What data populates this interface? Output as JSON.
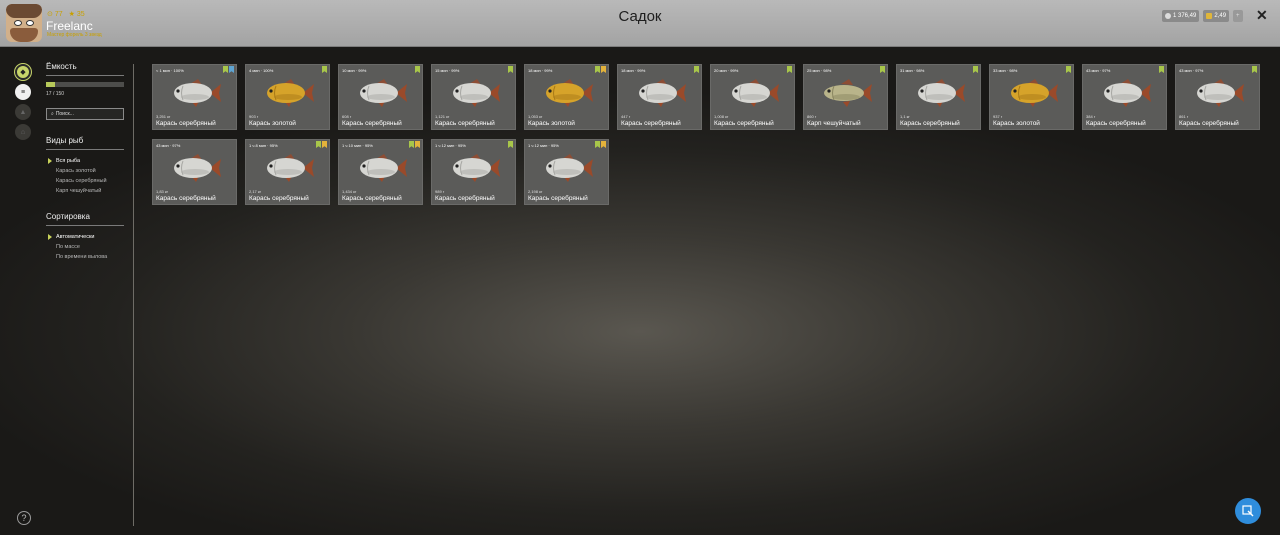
{
  "header": {
    "player_name": "Freelanc",
    "subtitle": "Мастер форель 3 звезд",
    "stat_level": "77",
    "stat_rank": "35",
    "title": "Садок",
    "silver": "1 376,49",
    "gold": "2,49",
    "plus": "+",
    "close": "✕"
  },
  "sidebar": {
    "capacity_title": "Ёмкость",
    "capacity_value": "17 / 150",
    "capacity_fraction": 0.113,
    "search_placeholder": "Поиск...",
    "species_title": "Виды рыб",
    "species": [
      "Вся рыба",
      "Карась золотой",
      "Карась серебряный",
      "Карп чешуйчатый"
    ],
    "sort_title": "Сортировка",
    "sort_options": [
      "Автоматически",
      "По массе",
      "По времени вылова"
    ],
    "help": "?"
  },
  "fish": [
    {
      "time": "< 1 мин · 100%",
      "weight": "3,251 кг",
      "name": "Карась серебряный",
      "kind": "silver",
      "tags": [
        "green",
        "blue"
      ]
    },
    {
      "time": "4 мин · 100%",
      "weight": "903 г",
      "name": "Карась золотой",
      "kind": "gold",
      "tags": [
        "green"
      ]
    },
    {
      "time": "10 мин · 99%",
      "weight": "608 г",
      "name": "Карась серебряный",
      "kind": "silver",
      "tags": [
        "green"
      ]
    },
    {
      "time": "15 мин · 99%",
      "weight": "1,121 кг",
      "name": "Карась серебряный",
      "kind": "silver",
      "tags": [
        "green"
      ]
    },
    {
      "time": "18 мин · 99%",
      "weight": "1,053 кг",
      "name": "Карась золотой",
      "kind": "gold",
      "tags": [
        "green",
        "gold"
      ]
    },
    {
      "time": "18 мин · 99%",
      "weight": "447 г",
      "name": "Карась серебряный",
      "kind": "silver",
      "tags": [
        "green"
      ]
    },
    {
      "time": "20 мин · 99%",
      "weight": "1,008 кг",
      "name": "Карась серебряный",
      "kind": "silver",
      "tags": [
        "green"
      ]
    },
    {
      "time": "25 мин · 98%",
      "weight": "860 г",
      "name": "Карп чешуйчатый",
      "kind": "carp",
      "tags": [
        "green"
      ]
    },
    {
      "time": "31 мин · 98%",
      "weight": "1,1 кг",
      "name": "Карась серебряный",
      "kind": "silver",
      "tags": [
        "green"
      ]
    },
    {
      "time": "33 мин · 98%",
      "weight": "937 г",
      "name": "Карась золотой",
      "kind": "gold",
      "tags": [
        "green"
      ]
    },
    {
      "time": "43 мин · 97%",
      "weight": "384 г",
      "name": "Карась серебряный",
      "kind": "silver",
      "tags": [
        "green"
      ]
    },
    {
      "time": "43 мин · 97%",
      "weight": "861 г",
      "name": "Карась серебряный",
      "kind": "silver",
      "tags": [
        "green"
      ]
    },
    {
      "time": "43 мин · 97%",
      "weight": "1,83 кг",
      "name": "Карась серебряный",
      "kind": "silver",
      "tags": []
    },
    {
      "time": "1 ч 8 мин · 95%",
      "weight": "2,17 кг",
      "name": "Карась серебряный",
      "kind": "silver",
      "tags": [
        "green",
        "gold"
      ]
    },
    {
      "time": "1 ч 10 мин · 95%",
      "weight": "1,434 кг",
      "name": "Карась серебряный",
      "kind": "silver",
      "tags": [
        "green",
        "gold"
      ]
    },
    {
      "time": "1 ч 12 мин · 95%",
      "weight": "989 г",
      "name": "Карась серебряный",
      "kind": "silver",
      "tags": [
        "green"
      ]
    },
    {
      "time": "1 ч 12 мин · 95%",
      "weight": "2,198 кг",
      "name": "Карась серебряный",
      "kind": "silver",
      "tags": [
        "green",
        "gold"
      ]
    }
  ],
  "colors": {
    "accent": "#c7d46a",
    "silver_body": "#d6d6d2",
    "gold_body": "#d6a32a",
    "carp_body": "#b9b48a",
    "fin": "#9a4a2a"
  }
}
